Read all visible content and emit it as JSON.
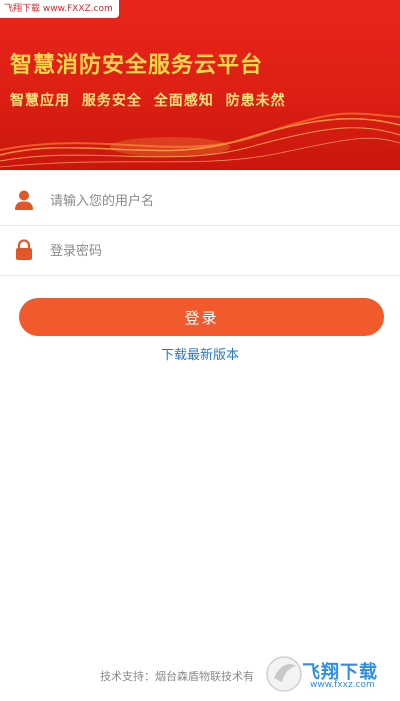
{
  "watermark": {
    "top": "飞翔下载 www.FXXZ.com",
    "brand": "飞翔下载",
    "url": "www.fxxz.com"
  },
  "banner": {
    "title": "智慧消防安全服务云平台",
    "slogan": "智慧应用  服务安全  全面感知  防患未然"
  },
  "login": {
    "username_placeholder": "请输入您的用户名",
    "password_placeholder": "登录密码",
    "submit_label": "登录",
    "download_label": "下载最新版本"
  },
  "footer": {
    "support_text": "技术支持：烟台森盾物联技术有"
  },
  "colors": {
    "banner": "#dd1f14",
    "title": "#ffd84a",
    "button": "#f05a2c",
    "link": "#2c78c4",
    "icon": "#e2572a"
  }
}
